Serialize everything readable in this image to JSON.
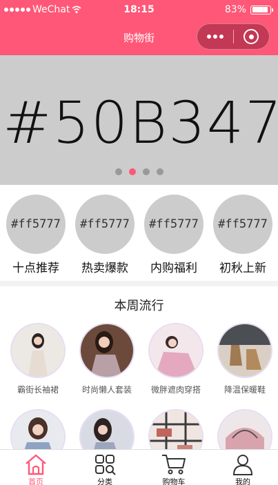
{
  "status_bar": {
    "carrier": "WeChat",
    "time": "18:15",
    "battery": "83%"
  },
  "nav": {
    "title": "购物街"
  },
  "banner": {
    "text": "#50B347",
    "indicator_count": 4,
    "active_index": 1
  },
  "recommend": [
    {
      "placeholder": "#ff5777",
      "label": "十点推荐"
    },
    {
      "placeholder": "#ff5777",
      "label": "热卖爆款"
    },
    {
      "placeholder": "#ff5777",
      "label": "内购福利"
    },
    {
      "placeholder": "#ff5777",
      "label": "初秋上新"
    }
  ],
  "weekly": {
    "title": "本周流行",
    "items": [
      {
        "label": "霸街长袖裙",
        "tone": "#e8e4df"
      },
      {
        "label": "时尚懒人套装",
        "tone": "#b79a8c"
      },
      {
        "label": "微胖遮肉穿搭",
        "tone": "#e9c6cf"
      },
      {
        "label": "降温保暖鞋",
        "tone": "#8a7a6a"
      },
      {
        "label": "",
        "tone": "#9fb1c9"
      },
      {
        "label": "",
        "tone": "#c7c9d6"
      },
      {
        "label": "",
        "tone": "#c9a29a"
      },
      {
        "label": "",
        "tone": "#d7aab1"
      }
    ]
  },
  "tabbar": [
    {
      "label": "首页",
      "icon": "home-icon",
      "active": true
    },
    {
      "label": "分类",
      "icon": "category-icon",
      "active": false
    },
    {
      "label": "购物车",
      "icon": "cart-icon",
      "active": false
    },
    {
      "label": "我的",
      "icon": "profile-icon",
      "active": false
    }
  ],
  "colors": {
    "accent": "#ff5777",
    "placeholder_gray": "#cccccc"
  }
}
